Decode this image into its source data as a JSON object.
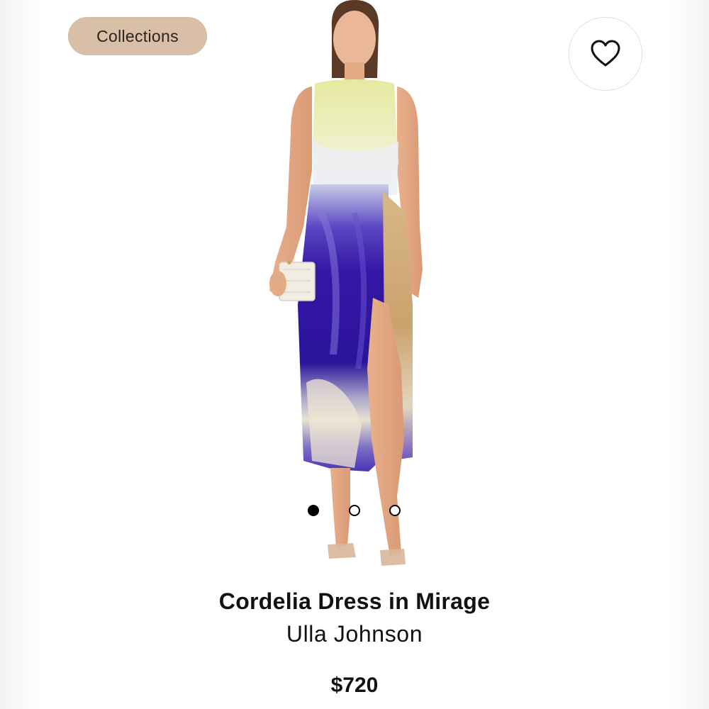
{
  "header": {
    "collections_label": "Collections"
  },
  "favorite": {
    "icon": "heart-outline-icon"
  },
  "gallery": {
    "image_count": 3,
    "active_index": 0
  },
  "product": {
    "name": "Cordelia Dress in Mirage",
    "brand": "Ulla Johnson",
    "price": "$720"
  },
  "colors": {
    "pill_background": "#d9bfa8",
    "text_primary": "#111111",
    "dress_violet": "#3b1fa8",
    "dress_gold": "#d7b782",
    "dress_lime": "#dfe39a"
  }
}
